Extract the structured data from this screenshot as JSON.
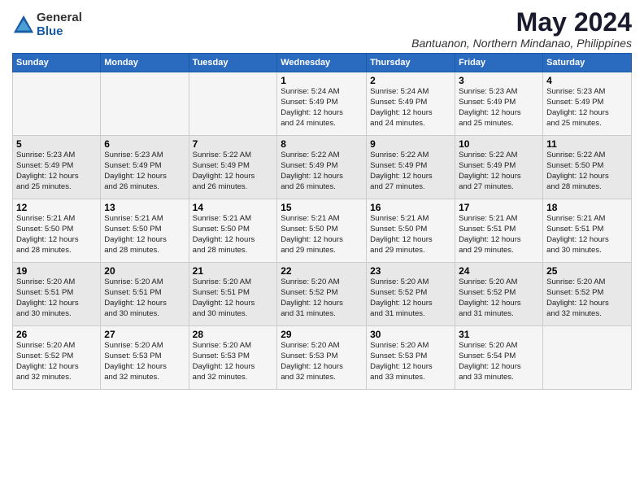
{
  "header": {
    "logo_general": "General",
    "logo_blue": "Blue",
    "month_title": "May 2024",
    "location": "Bantuanon, Northern Mindanao, Philippines"
  },
  "days_of_week": [
    "Sunday",
    "Monday",
    "Tuesday",
    "Wednesday",
    "Thursday",
    "Friday",
    "Saturday"
  ],
  "weeks": [
    [
      {
        "day": "",
        "info": ""
      },
      {
        "day": "",
        "info": ""
      },
      {
        "day": "",
        "info": ""
      },
      {
        "day": "1",
        "info": "Sunrise: 5:24 AM\nSunset: 5:49 PM\nDaylight: 12 hours\nand 24 minutes."
      },
      {
        "day": "2",
        "info": "Sunrise: 5:24 AM\nSunset: 5:49 PM\nDaylight: 12 hours\nand 24 minutes."
      },
      {
        "day": "3",
        "info": "Sunrise: 5:23 AM\nSunset: 5:49 PM\nDaylight: 12 hours\nand 25 minutes."
      },
      {
        "day": "4",
        "info": "Sunrise: 5:23 AM\nSunset: 5:49 PM\nDaylight: 12 hours\nand 25 minutes."
      }
    ],
    [
      {
        "day": "5",
        "info": "Sunrise: 5:23 AM\nSunset: 5:49 PM\nDaylight: 12 hours\nand 25 minutes."
      },
      {
        "day": "6",
        "info": "Sunrise: 5:23 AM\nSunset: 5:49 PM\nDaylight: 12 hours\nand 26 minutes."
      },
      {
        "day": "7",
        "info": "Sunrise: 5:22 AM\nSunset: 5:49 PM\nDaylight: 12 hours\nand 26 minutes."
      },
      {
        "day": "8",
        "info": "Sunrise: 5:22 AM\nSunset: 5:49 PM\nDaylight: 12 hours\nand 26 minutes."
      },
      {
        "day": "9",
        "info": "Sunrise: 5:22 AM\nSunset: 5:49 PM\nDaylight: 12 hours\nand 27 minutes."
      },
      {
        "day": "10",
        "info": "Sunrise: 5:22 AM\nSunset: 5:49 PM\nDaylight: 12 hours\nand 27 minutes."
      },
      {
        "day": "11",
        "info": "Sunrise: 5:22 AM\nSunset: 5:50 PM\nDaylight: 12 hours\nand 28 minutes."
      }
    ],
    [
      {
        "day": "12",
        "info": "Sunrise: 5:21 AM\nSunset: 5:50 PM\nDaylight: 12 hours\nand 28 minutes."
      },
      {
        "day": "13",
        "info": "Sunrise: 5:21 AM\nSunset: 5:50 PM\nDaylight: 12 hours\nand 28 minutes."
      },
      {
        "day": "14",
        "info": "Sunrise: 5:21 AM\nSunset: 5:50 PM\nDaylight: 12 hours\nand 28 minutes."
      },
      {
        "day": "15",
        "info": "Sunrise: 5:21 AM\nSunset: 5:50 PM\nDaylight: 12 hours\nand 29 minutes."
      },
      {
        "day": "16",
        "info": "Sunrise: 5:21 AM\nSunset: 5:50 PM\nDaylight: 12 hours\nand 29 minutes."
      },
      {
        "day": "17",
        "info": "Sunrise: 5:21 AM\nSunset: 5:51 PM\nDaylight: 12 hours\nand 29 minutes."
      },
      {
        "day": "18",
        "info": "Sunrise: 5:21 AM\nSunset: 5:51 PM\nDaylight: 12 hours\nand 30 minutes."
      }
    ],
    [
      {
        "day": "19",
        "info": "Sunrise: 5:20 AM\nSunset: 5:51 PM\nDaylight: 12 hours\nand 30 minutes."
      },
      {
        "day": "20",
        "info": "Sunrise: 5:20 AM\nSunset: 5:51 PM\nDaylight: 12 hours\nand 30 minutes."
      },
      {
        "day": "21",
        "info": "Sunrise: 5:20 AM\nSunset: 5:51 PM\nDaylight: 12 hours\nand 30 minutes."
      },
      {
        "day": "22",
        "info": "Sunrise: 5:20 AM\nSunset: 5:52 PM\nDaylight: 12 hours\nand 31 minutes."
      },
      {
        "day": "23",
        "info": "Sunrise: 5:20 AM\nSunset: 5:52 PM\nDaylight: 12 hours\nand 31 minutes."
      },
      {
        "day": "24",
        "info": "Sunrise: 5:20 AM\nSunset: 5:52 PM\nDaylight: 12 hours\nand 31 minutes."
      },
      {
        "day": "25",
        "info": "Sunrise: 5:20 AM\nSunset: 5:52 PM\nDaylight: 12 hours\nand 32 minutes."
      }
    ],
    [
      {
        "day": "26",
        "info": "Sunrise: 5:20 AM\nSunset: 5:52 PM\nDaylight: 12 hours\nand 32 minutes."
      },
      {
        "day": "27",
        "info": "Sunrise: 5:20 AM\nSunset: 5:53 PM\nDaylight: 12 hours\nand 32 minutes."
      },
      {
        "day": "28",
        "info": "Sunrise: 5:20 AM\nSunset: 5:53 PM\nDaylight: 12 hours\nand 32 minutes."
      },
      {
        "day": "29",
        "info": "Sunrise: 5:20 AM\nSunset: 5:53 PM\nDaylight: 12 hours\nand 32 minutes."
      },
      {
        "day": "30",
        "info": "Sunrise: 5:20 AM\nSunset: 5:53 PM\nDaylight: 12 hours\nand 33 minutes."
      },
      {
        "day": "31",
        "info": "Sunrise: 5:20 AM\nSunset: 5:54 PM\nDaylight: 12 hours\nand 33 minutes."
      },
      {
        "day": "",
        "info": ""
      }
    ]
  ]
}
